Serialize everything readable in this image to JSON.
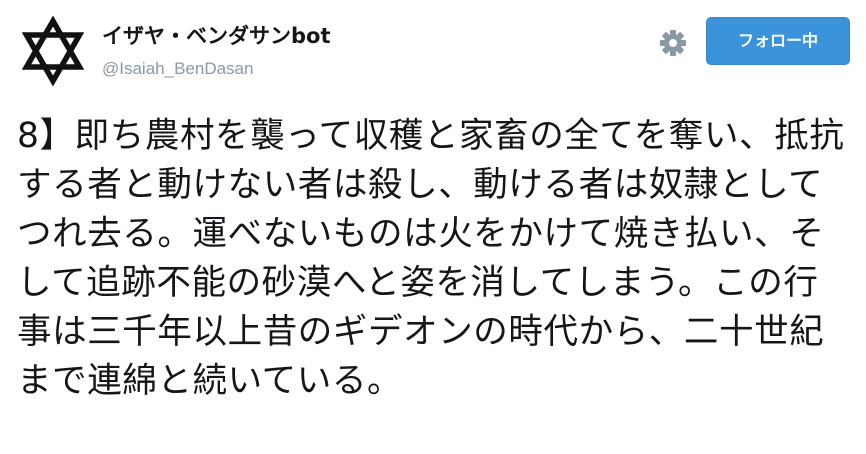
{
  "profile": {
    "display_name": "イザヤ・ベンダサンbot",
    "handle": "@Isaiah_BenDasan",
    "avatar_icon": "star-of-david-icon"
  },
  "actions": {
    "settings_icon": "gear-icon",
    "follow_label": "フォロー中",
    "follow_color": "#3b94d9"
  },
  "tweet": {
    "text": "8】即ち農村を襲って収穫と家畜の全てを奪い、抵抗する者と動けない者は殺し、動ける者は奴隷としてつれ去る。運べないものは火をかけて焼き払い、そして追跡不能の砂漠へと姿を消してしまう。この行事は三千年以上昔のギデオンの時代から、二十世紀まで連綿と続いている。"
  }
}
